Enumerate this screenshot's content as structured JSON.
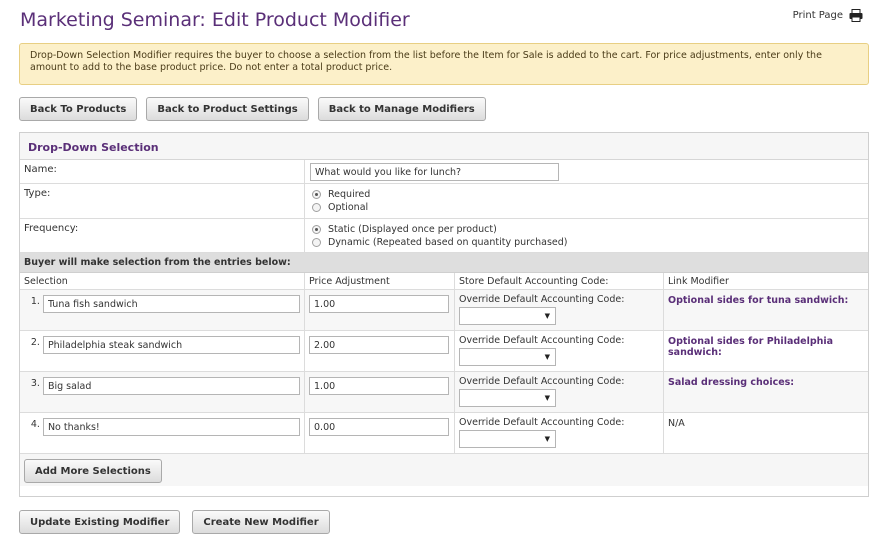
{
  "header": {
    "title": "Marketing Seminar: Edit Product Modifier",
    "print_label": "Print Page"
  },
  "notice": {
    "text": "Drop-Down Selection Modifier requires the buyer to choose a selection from the list before the Item for Sale is added to the cart. For price adjustments, enter only the amount to add to the base product price. Do not enter a total product price."
  },
  "nav_buttons": {
    "back_products": "Back To Products",
    "back_settings": "Back to Product Settings",
    "back_modifiers": "Back to Manage Modifiers"
  },
  "panel": {
    "title": "Drop-Down Selection",
    "name_label": "Name:",
    "name_value": "What would you like for lunch?",
    "type_label": "Type:",
    "type_options": [
      {
        "label": "Required",
        "selected": true
      },
      {
        "label": "Optional",
        "selected": false
      }
    ],
    "frequency_label": "Frequency:",
    "frequency_options": [
      {
        "label": "Static (Displayed once per product)",
        "selected": true
      },
      {
        "label": "Dynamic (Repeated based on quantity purchased)",
        "selected": false
      }
    ],
    "section_label": "Buyer will make selection from the entries below:",
    "columns": [
      "Selection",
      "Price Adjustment",
      "Store Default Accounting Code:",
      "Link Modifier"
    ],
    "selections": [
      {
        "num": "1.",
        "name": "Tuna fish sandwich",
        "price": "1.00",
        "override_label": "Override Default Accounting Code:",
        "link": "Optional sides for tuna sandwich:",
        "is_link": true
      },
      {
        "num": "2.",
        "name": "Philadelphia steak sandwich",
        "price": "2.00",
        "override_label": "Override Default Accounting Code:",
        "link": "Optional sides for Philadelphia sandwich:",
        "is_link": true
      },
      {
        "num": "3.",
        "name": "Big salad",
        "price": "1.00",
        "override_label": "Override Default Accounting Code:",
        "link": "Salad dressing choices:",
        "is_link": true
      },
      {
        "num": "4.",
        "name": "No thanks!",
        "price": "0.00",
        "override_label": "Override Default Accounting Code:",
        "link": "N/A",
        "is_link": false
      }
    ],
    "add_more_label": "Add More Selections"
  },
  "footer_buttons": {
    "update": "Update Existing Modifier",
    "create": "Create New Modifier"
  },
  "colors": {
    "accent": "#5a2f78",
    "notice_bg": "#fcf0c9",
    "section_bar": "#dedede"
  }
}
